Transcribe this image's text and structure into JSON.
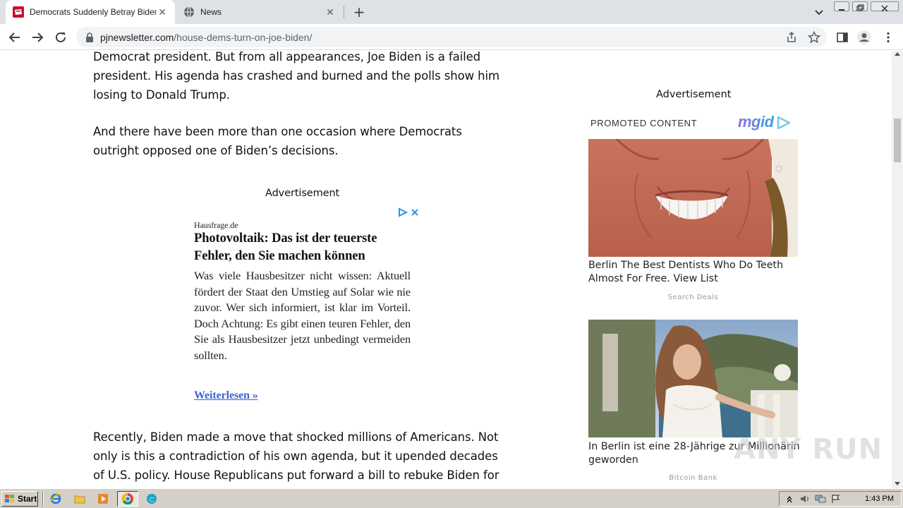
{
  "browser": {
    "tabs": [
      {
        "title": "Democrats Suddenly Betray Biden ov",
        "active": true,
        "favicon": "pj-media-icon"
      },
      {
        "title": "News",
        "active": false,
        "favicon": "globe-icon"
      }
    ],
    "new_tab_label": "+",
    "url_domain": "pjnewsletter.com",
    "url_path": "/house-dems-turn-on-joe-biden/"
  },
  "article": {
    "paragraph_1": "Democrat president. But from all appearances, Joe Biden is a failed president. His agenda has crashed and burned and the polls show him losing to Donald Trump.",
    "paragraph_2": "And there have been more than one occasion where Democrats outright opposed one of Biden’s decisions.",
    "paragraph_3": "Recently, Biden made a move that shocked millions of Americans. Not only is this a contradiction of his own agenda, but it upended decades of U.S. policy. House Republicans put forward a bill to rebuke Biden for"
  },
  "inline_ad": {
    "label": "Advertisement",
    "source": "Hausfrage.de",
    "headline": "Photovoltaik: Das ist der teuerste Fehler, den Sie machen können",
    "body": "Was viele Hausbesitzer nicht wissen: Aktuell fördert der Staat den Umstieg auf Solar wie nie zuvor. Wer sich informiert, ist klar im Vorteil. Doch Achtung: Es gibt einen teuren Fehler, den Sie als Hausbesitzer jetzt unbedingt vermeiden sollten.",
    "link": "Weiterlesen »"
  },
  "sidebar": {
    "label": "Advertisement",
    "promoted": "PROMOTED CONTENT",
    "logo": "mgid",
    "cards": [
      {
        "title": "Berlin The Best Dentists Who Do Teeth Almost For Free. View List",
        "source": "Search Deals"
      },
      {
        "title": "In Berlin ist eine 28-Jährige zur Millionärin geworden",
        "source": "Bitcoin Bank"
      }
    ]
  },
  "watermark": "ANY RUN",
  "taskbar": {
    "start_label": "Start",
    "clock": "1:43 PM"
  },
  "colors": {
    "tab_strip": "#dee1e6",
    "omnibox": "#f1f3f4",
    "ad_link": "#3b65d6",
    "mgid_logo": "#8e6fd8",
    "taskbar": "#d4d0c8"
  }
}
